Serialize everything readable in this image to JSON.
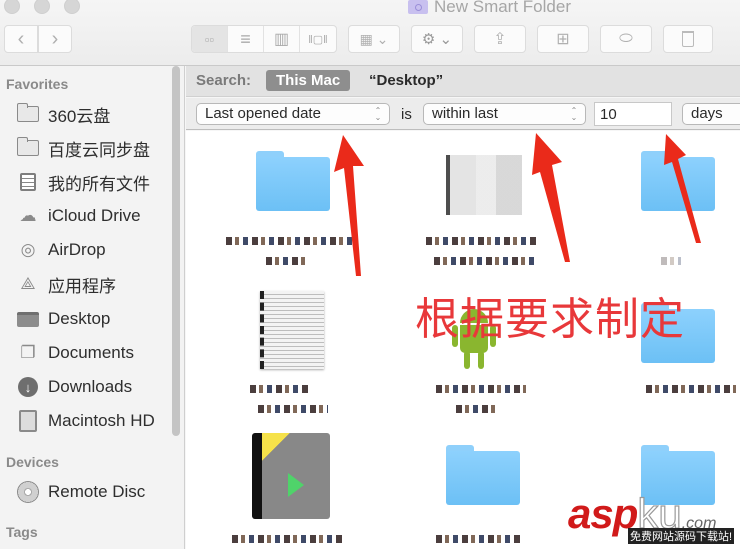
{
  "window": {
    "title": "New Smart Folder"
  },
  "toolbar": {
    "back_icon": "chevron-left-icon",
    "forward_icon": "chevron-right-icon",
    "view_modes": [
      {
        "name": "icon-view",
        "glyph": "▫▫",
        "active": true
      },
      {
        "name": "list-view",
        "glyph": "≡",
        "active": false
      },
      {
        "name": "column-view",
        "glyph": "▥",
        "active": false
      },
      {
        "name": "cover-flow-view",
        "glyph": "‖▢‖",
        "active": false
      }
    ],
    "arrange_glyph": "▦ ⌄",
    "action_glyph": "⚙ ⌄",
    "share_glyph": "⇪",
    "new_folder_glyph": "⊞",
    "tag_glyph": "⬭",
    "trash_glyph": "🗑"
  },
  "sidebar": {
    "sections": [
      {
        "header": "Favorites",
        "items": [
          {
            "label": "360云盘",
            "icon": "folder-icon"
          },
          {
            "label": "百度云同步盘",
            "icon": "folder-icon"
          },
          {
            "label": "我的所有文件",
            "icon": "all-files-icon"
          },
          {
            "label": "iCloud Drive",
            "icon": "cloud-icon"
          },
          {
            "label": "AirDrop",
            "icon": "airdrop-icon"
          },
          {
            "label": "应用程序",
            "icon": "applications-icon"
          },
          {
            "label": "Desktop",
            "icon": "desktop-icon"
          },
          {
            "label": "Documents",
            "icon": "documents-icon"
          },
          {
            "label": "Downloads",
            "icon": "downloads-icon"
          },
          {
            "label": "Macintosh HD",
            "icon": "hard-drive-icon"
          }
        ]
      },
      {
        "header": "Devices",
        "items": [
          {
            "label": "Remote Disc",
            "icon": "disc-icon"
          }
        ]
      },
      {
        "header": "Tags",
        "items": []
      }
    ]
  },
  "search": {
    "label": "Search:",
    "scope_active": "This Mac",
    "scope_other": "“Desktop”"
  },
  "criteria": {
    "attribute": "Last opened date",
    "operator_label": "is",
    "condition": "within last",
    "value": "10",
    "unit": "days"
  },
  "content": {
    "items": [
      {
        "type": "folder"
      },
      {
        "type": "document-thumbnail"
      },
      {
        "type": "folder"
      },
      {
        "type": "text-document"
      },
      {
        "type": "android-app"
      },
      {
        "type": "folder"
      },
      {
        "type": "app"
      },
      {
        "type": "folder"
      },
      {
        "type": "folder"
      }
    ]
  },
  "annotation": {
    "text": "根据要求制定",
    "color": "#e8383a"
  },
  "watermark": {
    "asp": "asp",
    "ku": "ku",
    "com": ".com",
    "sub": "免费网站源码下载站!"
  }
}
